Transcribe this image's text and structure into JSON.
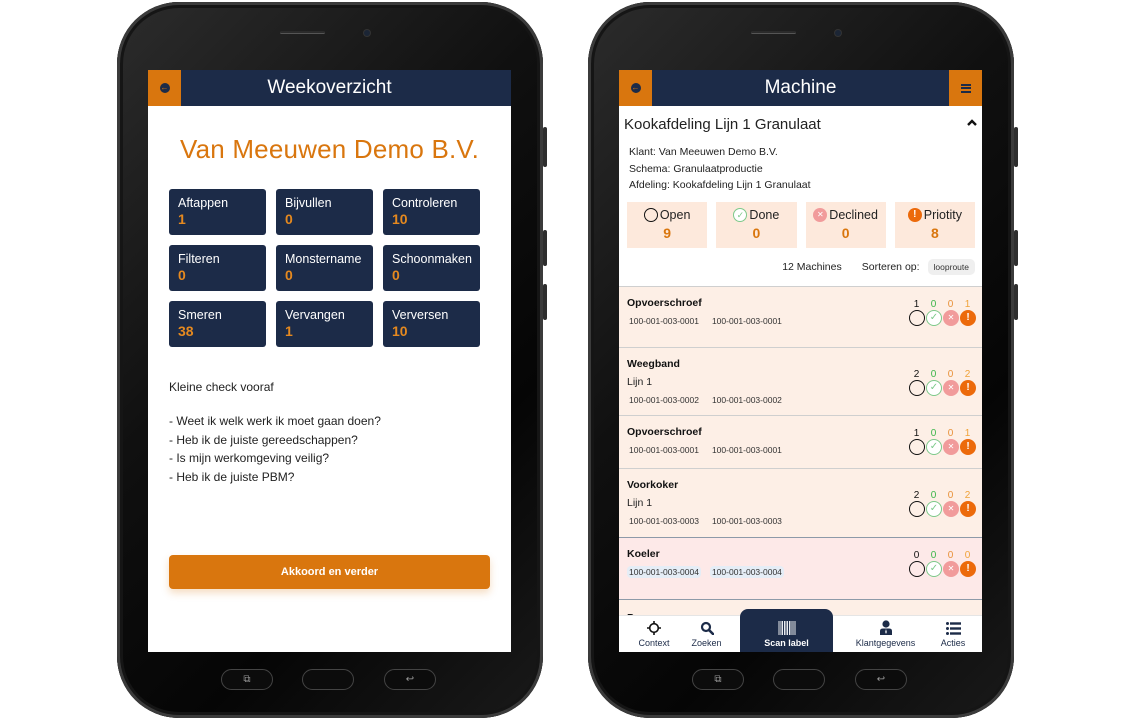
{
  "colors": {
    "navy": "#1c2b48",
    "orange": "#d9760e",
    "card_peach": "#fde9dc",
    "row_peach": "#fdefe6",
    "row_pink": "#fde9e8",
    "done_green": "#7dc98a",
    "declined_red": "#f19b9b",
    "priority_orange": "#ec6a0b"
  },
  "left_screen": {
    "title": "Weekoverzicht",
    "company": "Van Meeuwen Demo B.V.",
    "tasks": [
      {
        "name": "Aftappen",
        "count": "1"
      },
      {
        "name": "Bijvullen",
        "count": "0"
      },
      {
        "name": "Controleren",
        "count": "10"
      },
      {
        "name": "Filteren",
        "count": "0"
      },
      {
        "name": "Monstername",
        "count": "0"
      },
      {
        "name": "Schoonmaken",
        "count": "0"
      },
      {
        "name": "Smeren",
        "count": "38"
      },
      {
        "name": "Vervangen",
        "count": "1"
      },
      {
        "name": "Verversen",
        "count": "10"
      }
    ],
    "check_title": "Kleine check vooraf",
    "check_items": [
      "- Weet ik welk werk ik moet gaan doen?",
      "- Heb ik de juiste gereedschappen?",
      "- Is mijn werkomgeving veilig?",
      "- Heb ik de juiste PBM?"
    ],
    "agree_button": "Akkoord en verder"
  },
  "right_screen": {
    "title": "Machine",
    "section_title": "Kookafdeling Lijn 1 Granulaat",
    "info": {
      "klant": "Klant: Van Meeuwen Demo B.V.",
      "schema": "Schema: Granulaatproductie",
      "afdeling": "Afdeling: Kookafdeling Lijn 1 Granulaat"
    },
    "stats": [
      {
        "label": "Open",
        "value": "9",
        "icon": "open-circle-icon"
      },
      {
        "label": "Done",
        "value": "0",
        "icon": "check-circle-icon"
      },
      {
        "label": "Declined",
        "value": "0",
        "icon": "x-circle-icon"
      },
      {
        "label": "Priotity",
        "value": "8",
        "icon": "exclamation-circle-icon"
      }
    ],
    "machine_count": "12 Machines",
    "sort_label": "Sorteren op:",
    "sort_value": "looproute",
    "machines": [
      {
        "name": "Opvoerschroef",
        "sub": "",
        "codes": [
          "100-001-003-0001",
          "100-001-003-0001"
        ],
        "counts": [
          "1",
          "0",
          "0",
          "1"
        ]
      },
      {
        "name": "Weegband",
        "sub": "Lijn 1",
        "codes": [
          "100-001-003-0002",
          "100-001-003-0002"
        ],
        "counts": [
          "2",
          "0",
          "0",
          "2"
        ]
      },
      {
        "name": "Opvoerschroef",
        "sub": "",
        "codes": [
          "100-001-003-0001",
          "100-001-003-0001"
        ],
        "counts": [
          "1",
          "0",
          "0",
          "1"
        ]
      },
      {
        "name": "Voorkoker",
        "sub": "Lijn 1",
        "codes": [
          "100-001-003-0003",
          "100-001-003-0003"
        ],
        "counts": [
          "2",
          "0",
          "0",
          "2"
        ]
      },
      {
        "name": "Koeler",
        "sub": "",
        "codes": [
          "100-001-003-0004",
          "100-001-003-0004"
        ],
        "counts": [
          "0",
          "0",
          "0",
          "0"
        ]
      },
      {
        "name": "Pomp",
        "sub": "",
        "codes": [],
        "counts": []
      }
    ],
    "bottom_nav": {
      "context": "Context",
      "search": "Zoeken",
      "scan": "Scan label",
      "client": "Klantgegevens",
      "actions": "Acties"
    }
  },
  "glyphs": {
    "back": "←",
    "check": "✓",
    "x": "✕",
    "excl": "!",
    "chevron_up": "^",
    "recent_apps": "⧉",
    "hw_back": "↩"
  }
}
